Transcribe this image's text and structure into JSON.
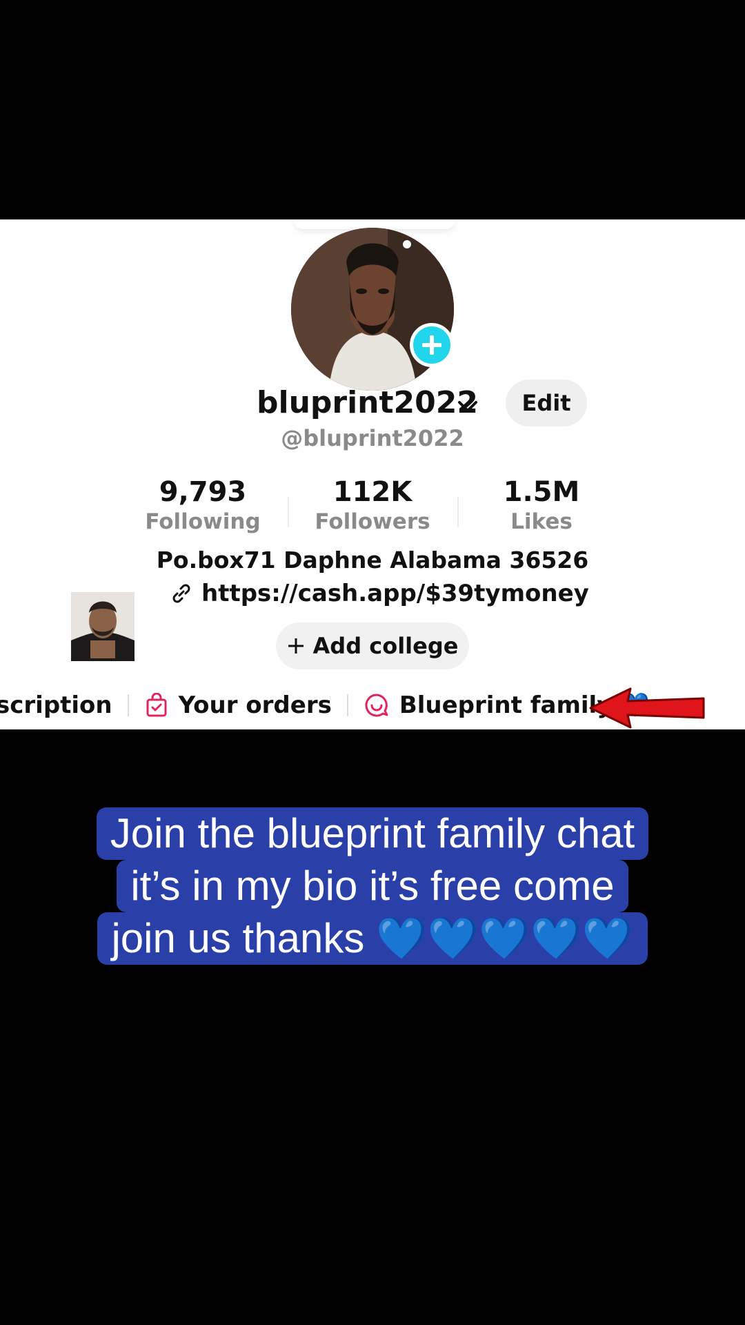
{
  "profile": {
    "username": "bluprint2022",
    "handle": "@bluprint2022",
    "edit_label": "Edit",
    "stats": [
      {
        "value": "9,793",
        "label": "Following"
      },
      {
        "value": "112K",
        "label": "Followers"
      },
      {
        "value": "1.5M",
        "label": "Likes"
      }
    ],
    "bio": "Po.box71 Daphne Alabama 36526",
    "link": "https://cash.app/$39tymoney",
    "add_college_label": "Add college"
  },
  "chips": [
    {
      "label": "scription",
      "icon": "none"
    },
    {
      "label": "Your orders",
      "icon": "shopping-bag-icon"
    },
    {
      "label": "Blueprint family 💙",
      "icon": "chat-bubble-icon"
    }
  ],
  "caption": {
    "lines": [
      "Join the blueprint family chat",
      "it’s in my bio it’s free come",
      "join us thanks 💙💙💙💙💙"
    ]
  },
  "colors": {
    "accent_cyan": "#20d5ec",
    "chip_pink": "#e0245e",
    "caption_bg": "#2a3fa8",
    "arrow_red": "#e0141b"
  }
}
